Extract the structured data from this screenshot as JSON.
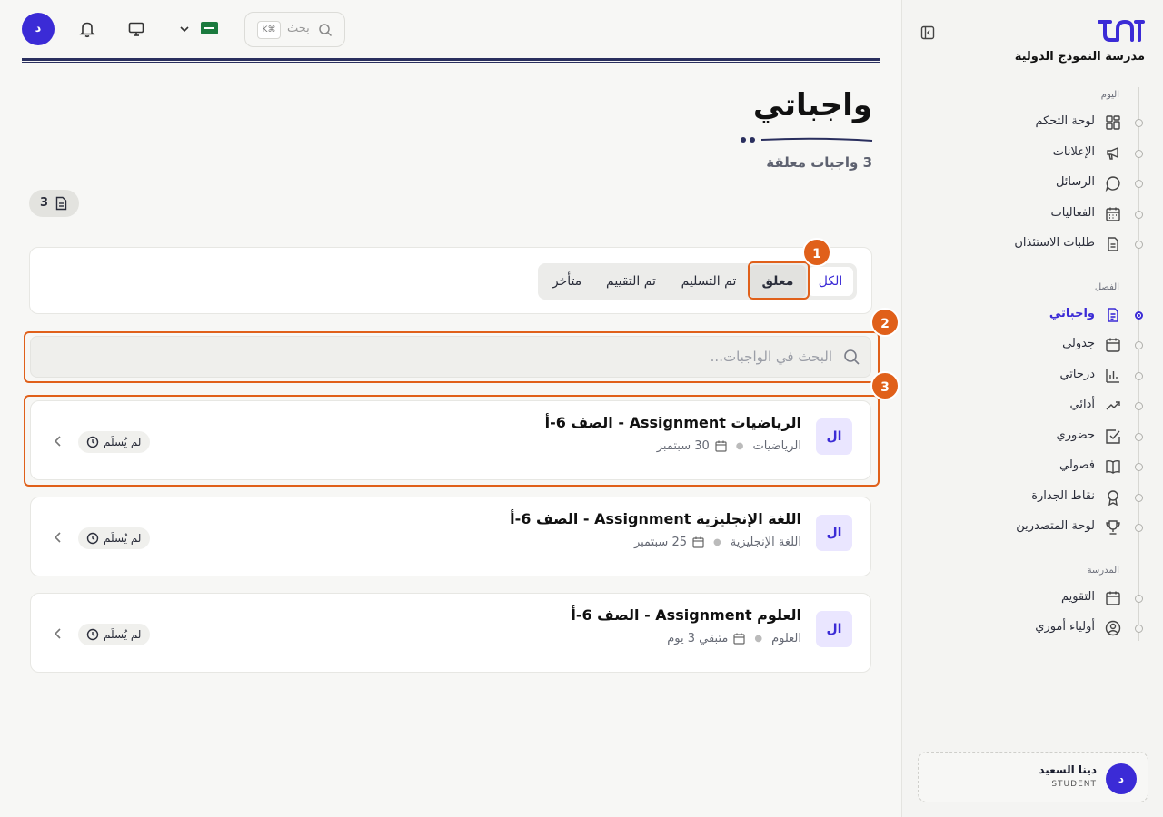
{
  "sidebar": {
    "school_name": "مدرسة النموذج الدولية",
    "sections": [
      {
        "label": "اليوم"
      },
      {
        "label": "الفصل"
      },
      {
        "label": "المدرسة"
      }
    ],
    "items": [
      {
        "label": "لوحة التحكم",
        "icon": "dashboard-icon"
      },
      {
        "label": "الإعلانات",
        "icon": "megaphone-icon"
      },
      {
        "label": "الرسائل",
        "icon": "chat-icon"
      },
      {
        "label": "الفعاليات",
        "icon": "calendar-grid-icon"
      },
      {
        "label": "طلبات الاستئذان",
        "icon": "document-icon"
      },
      {
        "label": "واجباتي",
        "icon": "assignment-icon",
        "active": true
      },
      {
        "label": "جدولي",
        "icon": "calendar-icon"
      },
      {
        "label": "درجاتي",
        "icon": "bar-chart-icon"
      },
      {
        "label": "أدائي",
        "icon": "trend-icon"
      },
      {
        "label": "حضوري",
        "icon": "check-square-icon"
      },
      {
        "label": "فصولي",
        "icon": "book-icon"
      },
      {
        "label": "نقاط الجدارة",
        "icon": "award-icon"
      },
      {
        "label": "لوحة المتصدرين",
        "icon": "trophy-icon"
      },
      {
        "label": "التقويم",
        "icon": "calendar-icon"
      },
      {
        "label": "أولياء أموري",
        "icon": "user-circle-icon"
      }
    ],
    "user": {
      "initial": "د",
      "name": "دينا السعيد",
      "role": "STUDENT"
    }
  },
  "topbar": {
    "avatar_initial": "د",
    "search_placeholder": "بحث",
    "shortcut": "K⌘"
  },
  "page": {
    "title": "واجباتي",
    "subtitle": "3 واجبات معلقة",
    "count": "3"
  },
  "filters": {
    "tabs": [
      "الكل",
      "معلق",
      "تم التسليم",
      "تم التقييم",
      "متأخر"
    ],
    "selected": "الكل"
  },
  "search": {
    "placeholder": "البحث في الواجبات..."
  },
  "callouts": [
    "1",
    "2",
    "3"
  ],
  "assignments": [
    {
      "badge": "ال",
      "title": "الرياضيات Assignment - الصف 6-أ",
      "subject": "الرياضيات",
      "due": "30 سبتمبر",
      "status": "لم يُسلَم"
    },
    {
      "badge": "ال",
      "title": "اللغة الإنجليزية Assignment - الصف 6-أ",
      "subject": "اللغة الإنجليزية",
      "due": "25 سبتمبر",
      "status": "لم يُسلَم"
    },
    {
      "badge": "ال",
      "title": "العلوم Assignment - الصف 6-أ",
      "subject": "العلوم",
      "due": "متبقي 3 يوم",
      "status": "لم يُسلَم"
    }
  ],
  "colors": {
    "accent": "#3b2bd6",
    "callout": "#e0601a",
    "rule": "#2a2f5e"
  }
}
